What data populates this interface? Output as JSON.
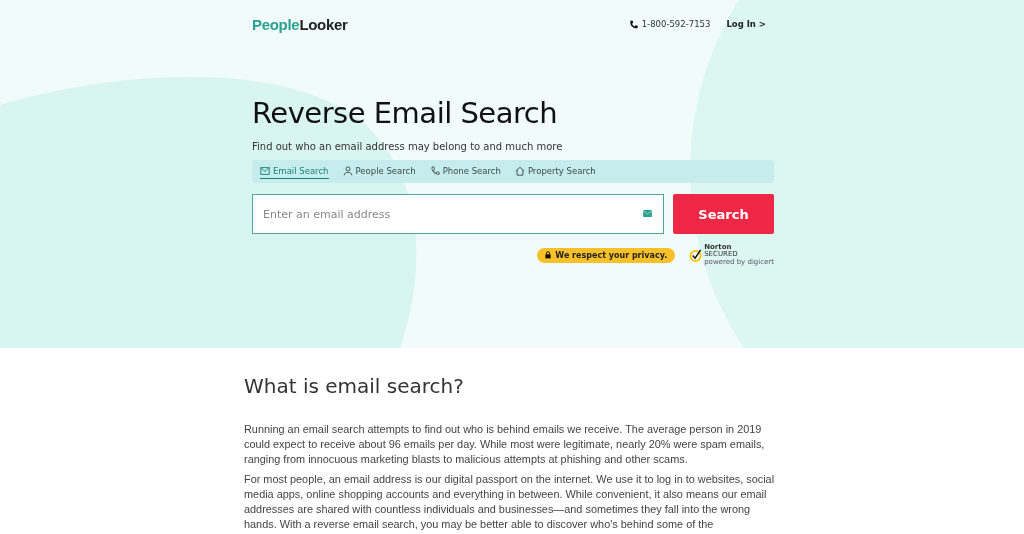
{
  "header": {
    "logo": {
      "first": "People",
      "second": "Looker"
    },
    "phone": "1-800-592-7153",
    "login": "Log In >"
  },
  "hero": {
    "title": "Reverse Email Search",
    "subtitle": "Find out who an email address may belong to and much more",
    "tabs": [
      {
        "label": "Email Search",
        "selected": true
      },
      {
        "label": "People Search",
        "selected": false
      },
      {
        "label": "Phone Search",
        "selected": false
      },
      {
        "label": "Property Search",
        "selected": false
      }
    ],
    "search": {
      "placeholder": "Enter an email address",
      "button": "Search"
    },
    "privacy": "We respect your privacy.",
    "norton": {
      "name": "Norton",
      "tag": "SECURED",
      "by": "powered by digicert"
    }
  },
  "article": {
    "heading": "What is email search?",
    "paragraphs": [
      "Running an email search attempts to find out who is behind emails we receive. The average person in 2019 could expect to receive about 96 emails per day. While most were legitimate, nearly 20% were spam emails, ranging from innocuous marketing blasts to malicious attempts at phishing and other scams.",
      "For most people, an email address is our digital passport on the internet. We use it to log in to websites, social media apps, online shopping accounts and everything in between. While convenient, it also means our email addresses are shared with countless individuals and businesses—and sometimes they fall into the wrong hands. With a reverse email search, you may be better able to discover who's behind some of the"
    ]
  }
}
